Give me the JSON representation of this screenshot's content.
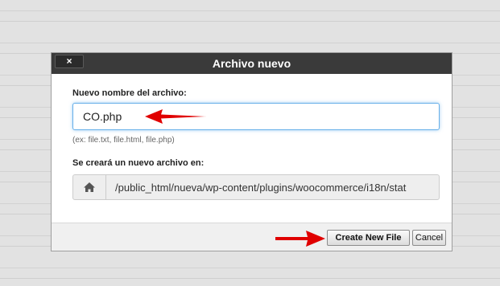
{
  "dialog": {
    "title": "Archivo nuevo",
    "close_label": "×"
  },
  "form": {
    "name_label": "Nuevo nombre del archivo:",
    "name_value": "CO.php",
    "hint": "(ex: file.txt, file.html, file.php)",
    "location_label": "Se creará un nuevo archivo en:",
    "location_path": "/public_html/nueva/wp-content/plugins/woocommerce/i18n/stat",
    "location_icon": "home-icon"
  },
  "footer": {
    "create_label": "Create New File",
    "cancel_label": "Cancel"
  },
  "annotations": {
    "arrow_color": "#e00000"
  }
}
